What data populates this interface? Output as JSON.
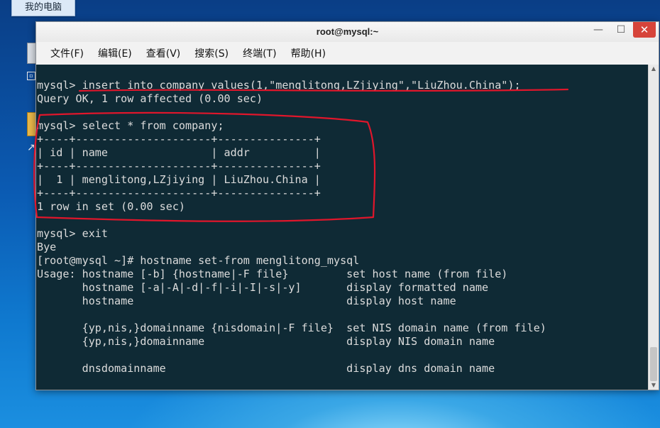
{
  "desktop": {
    "computer_label": "我的电脑"
  },
  "window": {
    "title": "root@mysql:~",
    "controls": {
      "minimize": "—",
      "maximize": "☐",
      "close": "✕"
    }
  },
  "menu": [
    "文件(F)",
    "编辑(E)",
    "查看(V)",
    "搜索(S)",
    "终端(T)",
    "帮助(H)"
  ],
  "terminal": {
    "lines": [
      "mysql> insert into company values(1,\"menglitong,LZjiying\",\"LiuZhou.China\");",
      "Query OK, 1 row affected (0.00 sec)",
      "",
      "mysql> select * from company;",
      "+----+---------------------+---------------+",
      "| id | name                | addr          |",
      "+----+---------------------+---------------+",
      "|  1 | menglitong,LZjiying | LiuZhou.China |",
      "+----+---------------------+---------------+",
      "1 row in set (0.00 sec)",
      "",
      "mysql> exit",
      "Bye",
      "[root@mysql ~]# hostname set-from menglitong_mysql",
      "Usage: hostname [-b] {hostname|-F file}         set host name (from file)",
      "       hostname [-a|-A|-d|-f|-i|-I|-s|-y]       display formatted name",
      "       hostname                                 display host name",
      "",
      "       {yp,nis,}domainname {nisdomain|-F file}  set NIS domain name (from file)",
      "       {yp,nis,}domainname                      display NIS domain name",
      "",
      "       dnsdomainname                            display dns domain name"
    ]
  },
  "annotation_color": "#e0162b"
}
